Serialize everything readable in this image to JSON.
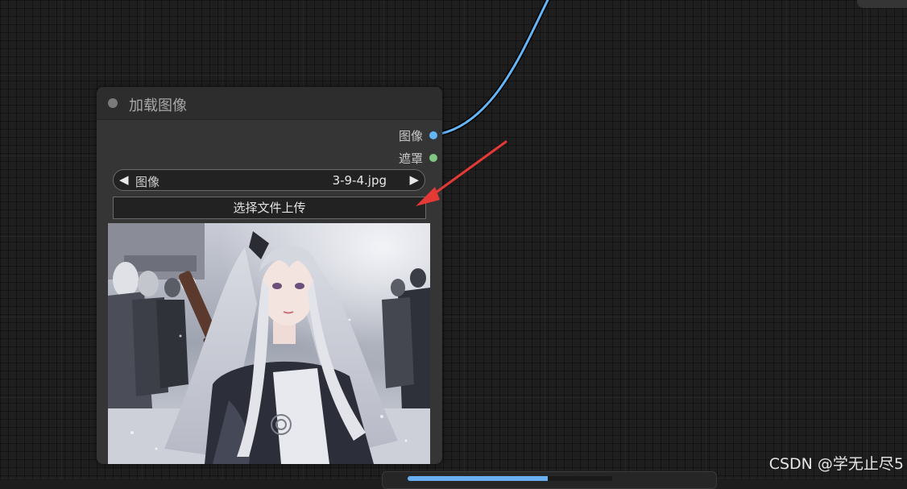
{
  "node": {
    "title": "加载图像",
    "outputs": [
      {
        "label": "图像",
        "color": "#64b5f6"
      },
      {
        "label": "遮罩",
        "color": "#81c784"
      }
    ],
    "image_widget": {
      "label": "图像",
      "value": "3-9-4.jpg",
      "left_arrow": "◀",
      "right_arrow": "▶"
    },
    "upload_button": "选择文件上传",
    "preview_icon": "anime-girl-swordswoman-image"
  },
  "watermark": "CSDN @学无止尽5",
  "colors": {
    "canvas": "#1e1e1e",
    "node_body": "#353535",
    "node_title": "#2d2d2d",
    "link": "#64b5f6",
    "annotation_arrow": "#e53935"
  }
}
